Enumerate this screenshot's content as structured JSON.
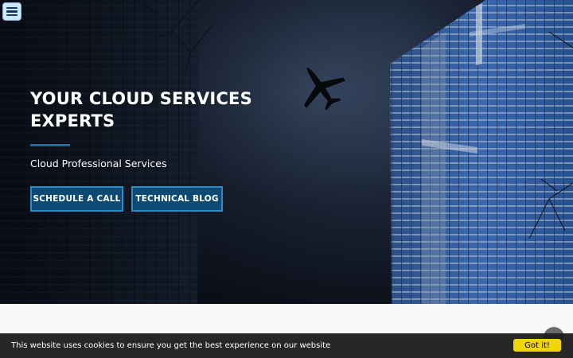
{
  "nav": {
    "menu_icon": "hamburger-menu-icon"
  },
  "hero": {
    "title": "YOUR CLOUD SERVICES EXPERTS",
    "subtitle": "Cloud Professional Services",
    "buttons": [
      {
        "label": "SCHEDULE A CALL"
      },
      {
        "label": "TECHNICAL BLOG"
      }
    ],
    "background_icon": "skyscrapers-airplane-photo"
  },
  "cookie": {
    "message": "This website uses cookies to ensure you get the best experience on our website",
    "accept_label": "Got it!"
  },
  "scroll_top": {
    "icon": "scroll-to-top-icon"
  },
  "colors": {
    "button_fill": "#0d4a73",
    "button_border": "#2e8cc4",
    "accent_line": "#1f6aa0",
    "cookie_button": "#f1d600",
    "cookie_bar": "#1e1e1e",
    "menu_button": "#cfe6f7"
  }
}
